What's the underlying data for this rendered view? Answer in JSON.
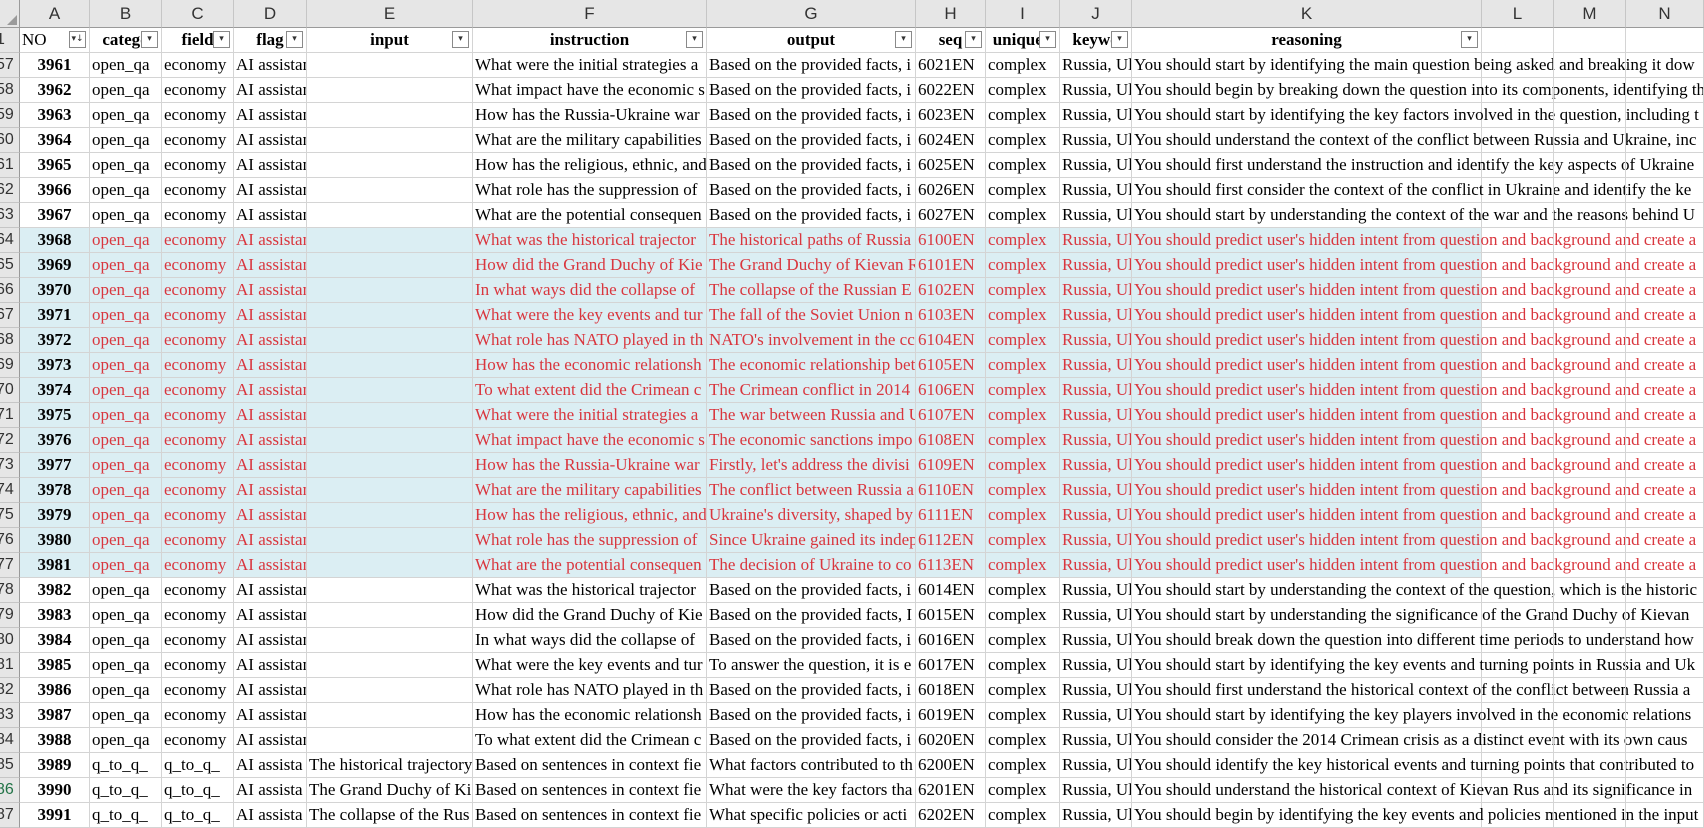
{
  "columns": [
    "A",
    "B",
    "C",
    "D",
    "E",
    "F",
    "G",
    "H",
    "I",
    "J",
    "K",
    "L",
    "M",
    "N"
  ],
  "headers": [
    "NO",
    "catego",
    "field",
    "flag",
    "input",
    "instruction",
    "output",
    "seq",
    "uniquen",
    "keywo",
    "reasoning"
  ],
  "rows": [
    {
      "r": "57",
      "no": "3961",
      "cat": "open_qa",
      "field": "economy",
      "flag": "AI assistant",
      "input": "",
      "instr": "What were the initial strategies a",
      "out": "Based on the provided facts, i",
      "seq": "6021EN",
      "uniq": "complex",
      "kw": "Russia, Ul",
      "reason": "You should start by identifying the main question being asked and breaking it dow",
      "hl": false
    },
    {
      "r": "58",
      "no": "3962",
      "cat": "open_qa",
      "field": "economy",
      "flag": "AI assistant",
      "input": "",
      "instr": "What impact have the economic s",
      "out": "Based on the provided facts, i",
      "seq": "6022EN",
      "uniq": "complex",
      "kw": "Russia, Ul",
      "reason": "You should begin by breaking down the question into its components, identifying th",
      "hl": false
    },
    {
      "r": "59",
      "no": "3963",
      "cat": "open_qa",
      "field": "economy",
      "flag": "AI assistant",
      "input": "",
      "instr": "How has the Russia-Ukraine war",
      "out": "Based on the provided facts, i",
      "seq": "6023EN",
      "uniq": "complex",
      "kw": "Russia, Ul",
      "reason": "You should start by identifying the key factors involved in the question, including t",
      "hl": false
    },
    {
      "r": "60",
      "no": "3964",
      "cat": "open_qa",
      "field": "economy",
      "flag": "AI assistant",
      "input": "",
      "instr": "What are the military capabilities",
      "out": "Based on the provided facts, i",
      "seq": "6024EN",
      "uniq": "complex",
      "kw": "Russia, Ul",
      "reason": "You should understand the context of the conflict between Russia and Ukraine, inc",
      "hl": false
    },
    {
      "r": "61",
      "no": "3965",
      "cat": "open_qa",
      "field": "economy",
      "flag": "AI assistant",
      "input": "",
      "instr": "How has the religious, ethnic, and",
      "out": "Based on the provided facts, i",
      "seq": "6025EN",
      "uniq": "complex",
      "kw": "Russia, Ul",
      "reason": "You should first understand the instruction and identify the key aspects of Ukraine",
      "hl": false
    },
    {
      "r": "62",
      "no": "3966",
      "cat": "open_qa",
      "field": "economy",
      "flag": "AI assistant",
      "input": "",
      "instr": "What role has the suppression of",
      "out": "Based on the provided facts, i",
      "seq": "6026EN",
      "uniq": "complex",
      "kw": "Russia, Ul",
      "reason": "You should first consider the context of the conflict in Ukraine and identify the ke",
      "hl": false
    },
    {
      "r": "63",
      "no": "3967",
      "cat": "open_qa",
      "field": "economy",
      "flag": "AI assistant",
      "input": "",
      "instr": "What are the potential consequen",
      "out": "Based on the provided facts, i",
      "seq": "6027EN",
      "uniq": "complex",
      "kw": "Russia, Ul",
      "reason": "You should start by understanding the context of the war and the reasons behind U",
      "hl": false
    },
    {
      "r": "64",
      "no": "3968",
      "cat": "open_qa",
      "field": "economy",
      "flag": "AI assistant",
      "input": "",
      "instr": "What was the historical trajector",
      "out": "The historical paths of Russia",
      "seq": "6100EN",
      "uniq": "complex",
      "kw": "Russia, Ul",
      "reason": "You should predict user's hidden intent from question and background and create a",
      "hl": true
    },
    {
      "r": "65",
      "no": "3969",
      "cat": "open_qa",
      "field": "economy",
      "flag": "AI assistant",
      "input": "",
      "instr": "How did the Grand Duchy of Kie",
      "out": "The Grand Duchy of Kievan R",
      "seq": "6101EN",
      "uniq": "complex",
      "kw": "Russia, Ul",
      "reason": "You should predict user's hidden intent from question and background and create a",
      "hl": true
    },
    {
      "r": "66",
      "no": "3970",
      "cat": "open_qa",
      "field": "economy",
      "flag": "AI assistant",
      "input": "",
      "instr": "In what ways did the collapse of",
      "out": "The collapse of the Russian E",
      "seq": "6102EN",
      "uniq": "complex",
      "kw": "Russia, Ul",
      "reason": "You should predict user's hidden intent from question and background and create a",
      "hl": true
    },
    {
      "r": "67",
      "no": "3971",
      "cat": "open_qa",
      "field": "economy",
      "flag": "AI assistant",
      "input": "",
      "instr": "What were the key events and tur",
      "out": "The fall of the Soviet Union n",
      "seq": "6103EN",
      "uniq": "complex",
      "kw": "Russia, Ul",
      "reason": "You should predict user's hidden intent from question and background and create a",
      "hl": true
    },
    {
      "r": "68",
      "no": "3972",
      "cat": "open_qa",
      "field": "economy",
      "flag": "AI assistant",
      "input": "",
      "instr": "What role has NATO played in th",
      "out": "NATO's involvement in the cc",
      "seq": "6104EN",
      "uniq": "complex",
      "kw": "Russia, Ul",
      "reason": "You should predict user's hidden intent from question and background and create a",
      "hl": true
    },
    {
      "r": "69",
      "no": "3973",
      "cat": "open_qa",
      "field": "economy",
      "flag": "AI assistant",
      "input": "",
      "instr": "How has the economic relationsh",
      "out": "The economic relationship bet",
      "seq": "6105EN",
      "uniq": "complex",
      "kw": "Russia, Ul",
      "reason": "You should predict user's hidden intent from question and background and create a",
      "hl": true
    },
    {
      "r": "70",
      "no": "3974",
      "cat": "open_qa",
      "field": "economy",
      "flag": "AI assistant",
      "input": "",
      "instr": "To what extent did the Crimean c",
      "out": "The Crimean conflict in 2014",
      "seq": "6106EN",
      "uniq": "complex",
      "kw": "Russia, Ul",
      "reason": "You should predict user's hidden intent from question and background and create a",
      "hl": true
    },
    {
      "r": "71",
      "no": "3975",
      "cat": "open_qa",
      "field": "economy",
      "flag": "AI assistant",
      "input": "",
      "instr": "What were the initial strategies a",
      "out": "The war between Russia and U",
      "seq": "6107EN",
      "uniq": "complex",
      "kw": "Russia, Ul",
      "reason": "You should predict user's hidden intent from question and background and create a",
      "hl": true
    },
    {
      "r": "72",
      "no": "3976",
      "cat": "open_qa",
      "field": "economy",
      "flag": "AI assistant",
      "input": "",
      "instr": "What impact have the economic s",
      "out": "The economic sanctions impo",
      "seq": "6108EN",
      "uniq": "complex",
      "kw": "Russia, Ul",
      "reason": "You should predict user's hidden intent from question and background and create a",
      "hl": true
    },
    {
      "r": "73",
      "no": "3977",
      "cat": "open_qa",
      "field": "economy",
      "flag": "AI assistant",
      "input": "",
      "instr": "How has the Russia-Ukraine war",
      "out": "Firstly, let's address the divisi",
      "seq": "6109EN",
      "uniq": "complex",
      "kw": "Russia, Ul",
      "reason": "You should predict user's hidden intent from question and background and create a",
      "hl": true
    },
    {
      "r": "74",
      "no": "3978",
      "cat": "open_qa",
      "field": "economy",
      "flag": "AI assistant",
      "input": "",
      "instr": "What are the military capabilities",
      "out": "The conflict between Russia a",
      "seq": "6110EN",
      "uniq": "complex",
      "kw": "Russia, Ul",
      "reason": "You should predict user's hidden intent from question and background and create a",
      "hl": true
    },
    {
      "r": "75",
      "no": "3979",
      "cat": "open_qa",
      "field": "economy",
      "flag": "AI assistant",
      "input": "",
      "instr": "How has the religious, ethnic, and",
      "out": "Ukraine's diversity, shaped by",
      "seq": "6111EN",
      "uniq": "complex",
      "kw": "Russia, Ul",
      "reason": "You should predict user's hidden intent from question and background and create a",
      "hl": true
    },
    {
      "r": "76",
      "no": "3980",
      "cat": "open_qa",
      "field": "economy",
      "flag": "AI assistant",
      "input": "",
      "instr": "What role has the suppression of",
      "out": "Since Ukraine gained its indep",
      "seq": "6112EN",
      "uniq": "complex",
      "kw": "Russia, Ul",
      "reason": "You should predict user's hidden intent from question and background and create a",
      "hl": true
    },
    {
      "r": "77",
      "no": "3981",
      "cat": "open_qa",
      "field": "economy",
      "flag": "AI assistant",
      "input": "",
      "instr": "What are the potential consequen",
      "out": "The decision of Ukraine to co",
      "seq": "6113EN",
      "uniq": "complex",
      "kw": "Russia, Ul",
      "reason": "You should predict user's hidden intent from question and background and create a",
      "hl": true
    },
    {
      "r": "78",
      "no": "3982",
      "cat": "open_qa",
      "field": "economy",
      "flag": "AI assistant",
      "input": "",
      "instr": "What was the historical trajector",
      "out": "Based on the provided facts, i",
      "seq": "6014EN",
      "uniq": "complex",
      "kw": "Russia, Ul",
      "reason": "You should start by understanding the context of the question, which is the historic",
      "hl": false
    },
    {
      "r": "79",
      "no": "3983",
      "cat": "open_qa",
      "field": "economy",
      "flag": "AI assistant",
      "input": "",
      "instr": "How did the Grand Duchy of Kie",
      "out": "Based on the provided facts, I",
      "seq": "6015EN",
      "uniq": "complex",
      "kw": "Russia, Ul",
      "reason": "You should start by understanding the significance of the Grand Duchy of Kievan",
      "hl": false
    },
    {
      "r": "80",
      "no": "3984",
      "cat": "open_qa",
      "field": "economy",
      "flag": "AI assistant",
      "input": "",
      "instr": "In what ways did the collapse of",
      "out": "Based on the provided facts, i",
      "seq": "6016EN",
      "uniq": "complex",
      "kw": "Russia, Ul",
      "reason": "You should break down the question into different time periods to understand how",
      "hl": false
    },
    {
      "r": "81",
      "no": "3985",
      "cat": "open_qa",
      "field": "economy",
      "flag": "AI assistant",
      "input": "",
      "instr": "What were the key events and tur",
      "out": "To answer the question, it is e",
      "seq": "6017EN",
      "uniq": "complex",
      "kw": "Russia, Ul",
      "reason": "You should start by identifying the key events and turning points in Russia and Uk",
      "hl": false
    },
    {
      "r": "82",
      "no": "3986",
      "cat": "open_qa",
      "field": "economy",
      "flag": "AI assistant",
      "input": "",
      "instr": "What role has NATO played in th",
      "out": "Based on the provided facts, i",
      "seq": "6018EN",
      "uniq": "complex",
      "kw": "Russia, Ul",
      "reason": "You should first understand the historical context of the conflict between Russia a",
      "hl": false
    },
    {
      "r": "83",
      "no": "3987",
      "cat": "open_qa",
      "field": "economy",
      "flag": "AI assistant",
      "input": "",
      "instr": "How has the economic relationsh",
      "out": "Based on the provided facts, i",
      "seq": "6019EN",
      "uniq": "complex",
      "kw": "Russia, Ul",
      "reason": "You should start by identifying the key players involved in the economic relations",
      "hl": false
    },
    {
      "r": "84",
      "no": "3988",
      "cat": "open_qa",
      "field": "economy",
      "flag": "AI assistant",
      "input": "",
      "instr": "To what extent did the Crimean c",
      "out": "Based on the provided facts, i",
      "seq": "6020EN",
      "uniq": "complex",
      "kw": "Russia, Ul",
      "reason": "You should consider the 2014 Crimean crisis as a distinct event with its own caus",
      "hl": false
    },
    {
      "r": "85",
      "no": "3989",
      "cat": "q_to_q_",
      "field": "q_to_q_",
      "flag": "AI assista",
      "input": "The historical trajectory",
      "instr": "Based on sentences in context fie",
      "out": "What factors contributed to th",
      "seq": "6200EN",
      "uniq": "complex",
      "kw": "Russia, Ul",
      "reason": "You should identify the key historical events and turning points that contributed to",
      "hl": false
    },
    {
      "r": "86",
      "no": "3990",
      "cat": "q_to_q_",
      "field": "q_to_q_",
      "flag": "AI assista",
      "input": "The Grand Duchy of Ki",
      "instr": "Based on sentences in context fie",
      "out": "What were the key factors tha",
      "seq": "6201EN",
      "uniq": "complex",
      "kw": "Russia, Ul",
      "reason": "You should understand the historical context of Kievan Rus and its significance in",
      "hl": false
    },
    {
      "r": "87",
      "no": "3991",
      "cat": "q_to_q_",
      "field": "q_to_q_",
      "flag": "AI assista",
      "input": "The collapse of the Rus",
      "instr": "Based on sentences in context fie",
      "out": "What specific policies or acti",
      "seq": "6202EN",
      "uniq": "complex",
      "kw": "Russia, Ul",
      "reason": "You should begin by identifying the key events and policies mentioned in the input",
      "hl": false
    }
  ],
  "selected_row": "86"
}
